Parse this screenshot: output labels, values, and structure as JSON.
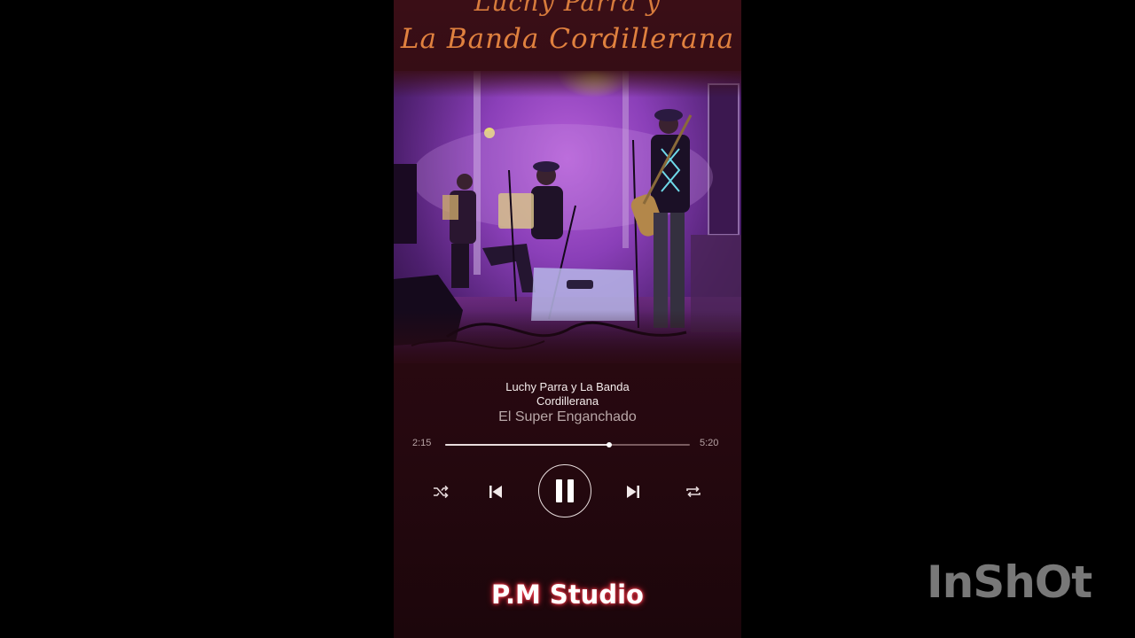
{
  "cover_header": {
    "line1": "Luchy Parra y",
    "line2": "La Banda Cordillerana"
  },
  "track": {
    "artist": "Luchy Parra y La Banda Cordillerana",
    "title": "El Super Enganchado"
  },
  "playback": {
    "elapsed": "2:15",
    "duration": "5:20",
    "progress_fraction": 0.672,
    "state": "playing"
  },
  "controls": {
    "shuffle_icon": "shuffle-icon",
    "previous_icon": "skip-previous-icon",
    "play_pause_icon": "pause-icon",
    "next_icon": "skip-next-icon",
    "repeat_icon": "repeat-icon"
  },
  "studio_label": "P.M Studio",
  "watermark": "InShOt",
  "colors": {
    "background": "#2c0a12",
    "header_script": "#e0813f",
    "studio_glow": "#e23a4a"
  }
}
